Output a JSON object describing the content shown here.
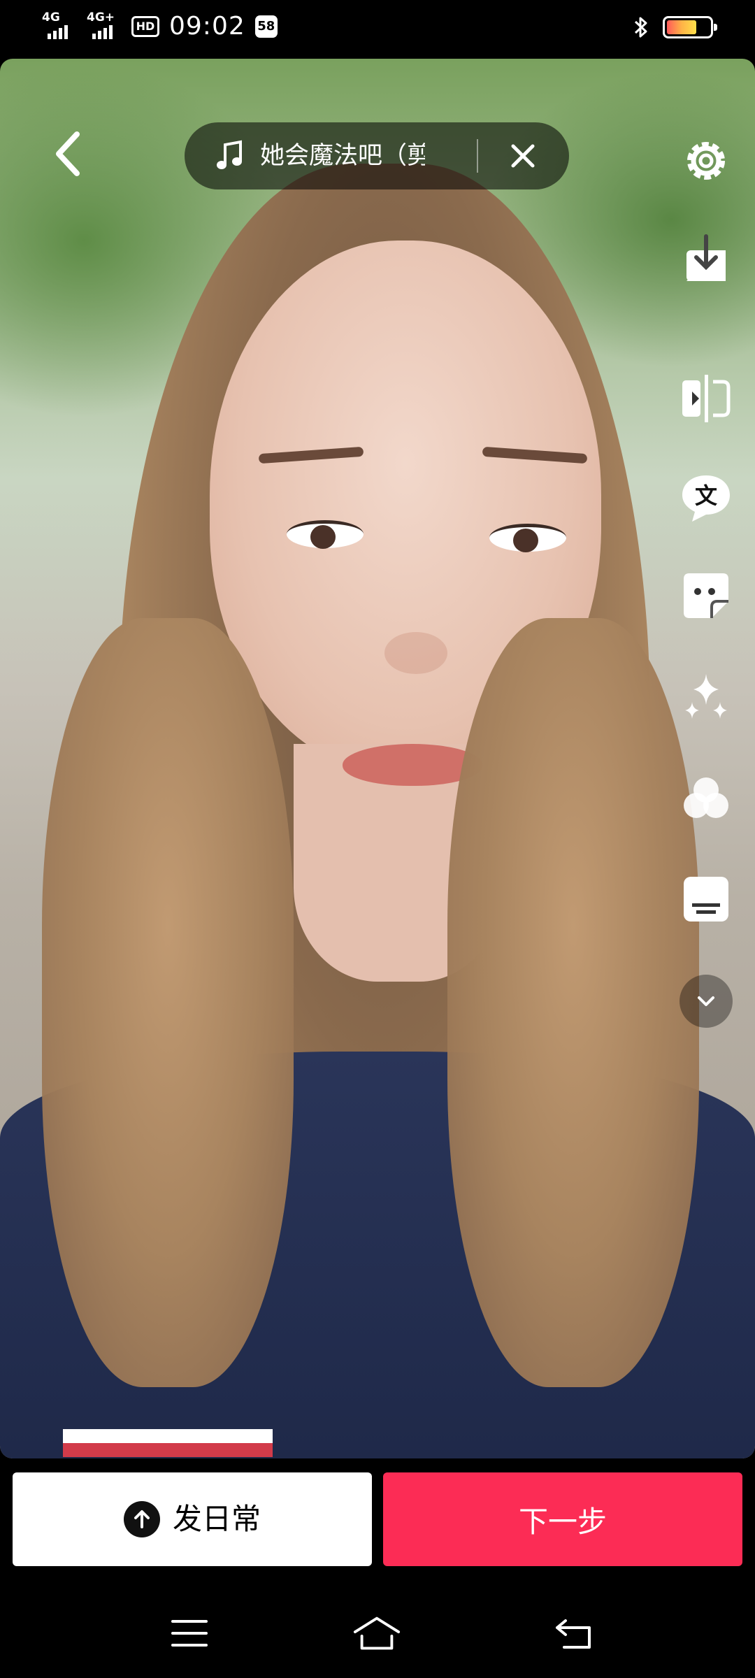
{
  "status_bar": {
    "network_1": "4G",
    "network_2": "4G+",
    "hd_badge": "HD",
    "time": "09:02",
    "notification_count": "58",
    "battery_level": 0.7,
    "battery_colors": [
      "#ff5a5a",
      "#ffb347",
      "#ffe04a"
    ]
  },
  "top_bar": {
    "back_icon": "chevron-left-icon",
    "music": {
      "icon": "music-note-icon",
      "title": "她会魔法吧（剪",
      "close_icon": "close-icon"
    }
  },
  "side_tools": [
    {
      "name": "settings-icon",
      "label": ""
    },
    {
      "name": "download-icon",
      "label": ""
    },
    {
      "name": "flip-camera-icon",
      "label": ""
    },
    {
      "name": "text-icon",
      "label": "文"
    },
    {
      "name": "sticker-icon",
      "label": ""
    },
    {
      "name": "effects-sparkle-icon",
      "label": ""
    },
    {
      "name": "filter-icon",
      "label": ""
    },
    {
      "name": "subtitle-icon",
      "label": ""
    },
    {
      "name": "more-chevron-down-icon",
      "label": ""
    }
  ],
  "actions": {
    "daily_label": "发日常",
    "next_label": "下一步",
    "next_color": "#fc2c55"
  },
  "nav_bar": {
    "menu_icon": "menu-icon",
    "home_icon": "home-icon",
    "back_icon": "back-icon"
  }
}
